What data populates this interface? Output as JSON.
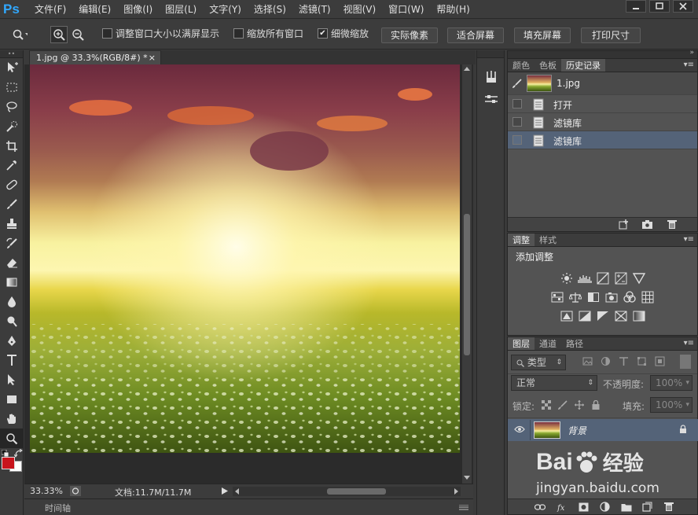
{
  "menubar": {
    "logo": "Ps",
    "items": [
      "文件(F)",
      "编辑(E)",
      "图像(I)",
      "图层(L)",
      "文字(Y)",
      "选择(S)",
      "滤镜(T)",
      "视图(V)",
      "窗口(W)",
      "帮助(H)"
    ]
  },
  "options": {
    "resize_windows": "调整窗口大小以满屏显示",
    "zoom_all": "缩放所有窗口",
    "scrubby_zoom": "细微缩放",
    "actual_pixels": "实际像素",
    "fit_screen": "适合屏幕",
    "fill_screen": "填充屏幕",
    "print_size": "打印尺寸",
    "scrubby_checked_mark": "✔"
  },
  "document": {
    "tab_title": "1.jpg @ 33.3%(RGB/8#) *",
    "close": "×",
    "zoom": "33.33%",
    "doc_size": "文档:11.7M/11.7M"
  },
  "timeline": {
    "label": "时间轴"
  },
  "history_panel": {
    "tabs": [
      "颜色",
      "色板",
      "历史记录"
    ],
    "snapshot_name": "1.jpg",
    "items": [
      {
        "label": "打开",
        "selected": false
      },
      {
        "label": "滤镜库",
        "selected": false
      },
      {
        "label": "滤镜库",
        "selected": true
      }
    ]
  },
  "adjust_panel": {
    "tabs": [
      "调整",
      "样式"
    ],
    "heading": "添加调整"
  },
  "layers_panel": {
    "tabs": [
      "图层",
      "通道",
      "路径"
    ],
    "filter_type": "类型",
    "blend_mode": "正常",
    "opacity_label": "不透明度:",
    "opacity_value": "100%",
    "lock_label": "锁定:",
    "fill_label": "填充:",
    "fill_value": "100%",
    "layer_name": "背景"
  },
  "watermark": {
    "brand": "Bai",
    "brand_cn": "经验",
    "url": "jingyan.baidu.com"
  },
  "colors": {
    "accent": "#31a8ff",
    "selection": "#546378",
    "foreground": "#c8141c"
  }
}
